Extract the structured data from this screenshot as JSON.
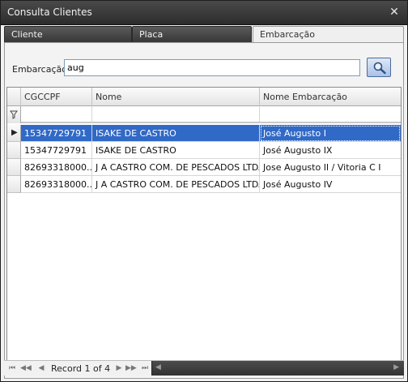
{
  "window": {
    "title": "Consulta Clientes",
    "close_glyph": "✕"
  },
  "tabs": [
    {
      "label": "Cliente"
    },
    {
      "label": "Placa"
    },
    {
      "label": "Embarcação"
    }
  ],
  "search": {
    "label": "Embarcação:",
    "value": "aug",
    "button_icon": "search-icon"
  },
  "grid": {
    "columns": [
      "CGCCPF",
      "Nome",
      "Nome Embarcação"
    ],
    "rows": [
      {
        "cgccpf": "15347729791",
        "nome": "ISAKE DE CASTRO",
        "embarcacao": "José Augusto I",
        "selected": true
      },
      {
        "cgccpf": "15347729791",
        "nome": "ISAKE DE CASTRO",
        "embarcacao": "José Augusto IX",
        "selected": false
      },
      {
        "cgccpf": "82693318000...",
        "nome": "J A CASTRO COM. DE PESCADOS LTDA...",
        "embarcacao": "Jose Augusto II / Vitoria C I",
        "selected": false
      },
      {
        "cgccpf": "82693318000...",
        "nome": "J A CASTRO COM. DE PESCADOS LTDA...",
        "embarcacao": "José Augusto IV",
        "selected": false
      }
    ]
  },
  "navigator": {
    "record_text": "Record 1 of 4"
  },
  "colors": {
    "selection": "#3169c6",
    "titlebar": "#3a3a3a"
  }
}
